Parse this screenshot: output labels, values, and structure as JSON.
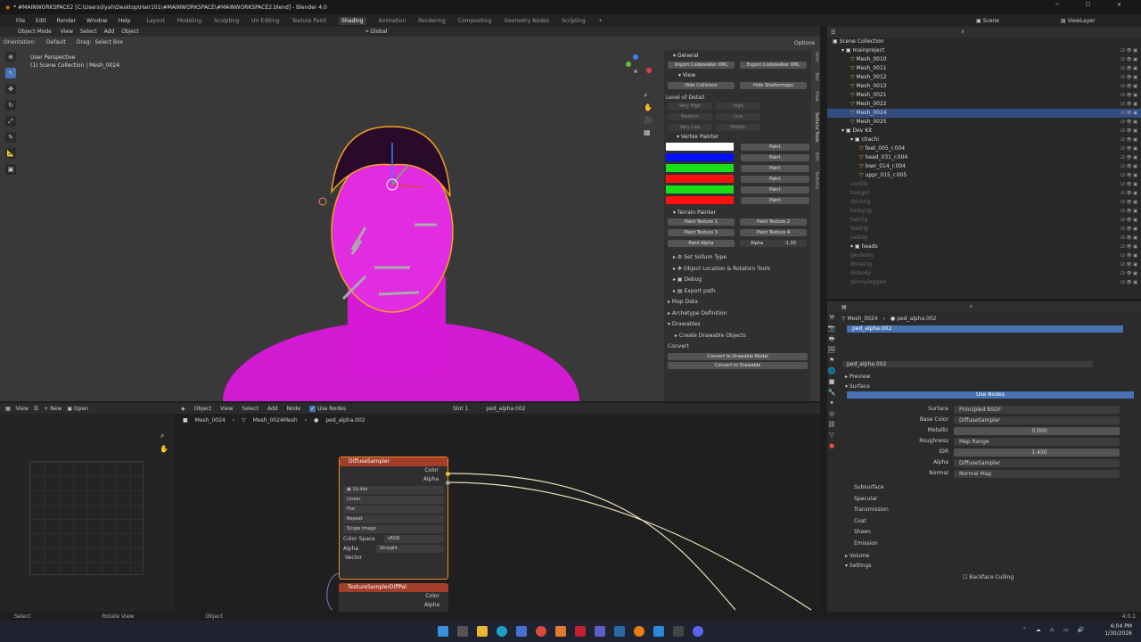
{
  "window": {
    "title": "* #MAINWORKSPACE2 [C:\\Users\\ilyah\\Desktop\\Hair101\\#MAINWORKSPACE\\#MAINWORKSPACE2.blend] - Blender 4.0"
  },
  "menu": [
    "File",
    "Edit",
    "Render",
    "Window",
    "Help"
  ],
  "workspaces": [
    "Layout",
    "Modeling",
    "Sculpting",
    "UV Editing",
    "Texture Paint",
    "Shading",
    "Animation",
    "Rendering",
    "Compositing",
    "Geometry Nodes",
    "Scripting"
  ],
  "active_workspace": "Shading",
  "scene": {
    "label": "Scene",
    "viewlayer": "ViewLayer"
  },
  "viewport": {
    "mode": "Object Mode",
    "view": "View",
    "select": "Select",
    "add": "Add",
    "object": "Object",
    "orientation_label": "Orientation:",
    "orientation": "Default",
    "drag_label": "Drag:",
    "drag": "Select Box",
    "transform": "Global",
    "options": "Options",
    "overlay_title": "User Perspective",
    "overlay_sub": "(1) Scene Collection | Mesh_0024"
  },
  "npanel": {
    "general": "General",
    "import_xml": "Import Codewalker XML",
    "export_xml": "Export Codewalker XML",
    "view": "View",
    "hide_collisions": "Hide Collisions",
    "hide_shattermaps": "Hide Shattermaps",
    "lod_title": "Level of Detail",
    "lod_buttons": [
      "Very High",
      "High",
      "Medium",
      "Low",
      "Very Low",
      "Hidden"
    ],
    "vertex_painter": "Vertex Painter",
    "paint_rows": [
      {
        "color": "#ffffff",
        "label": "Paint"
      },
      {
        "color": "#0010ff",
        "label": "Paint"
      },
      {
        "color": "#18e018",
        "label": "Paint"
      },
      {
        "color": "#ff1010",
        "label": "Paint"
      },
      {
        "color": "#18e018",
        "label": "Paint"
      },
      {
        "color": "#ff1010",
        "label": "Paint"
      }
    ],
    "terrain_painter": "Terrain Painter",
    "terrain_buttons": [
      "Paint Texture 1",
      "Paint Texture 2",
      "Paint Texture 3",
      "Paint Texture 4"
    ],
    "paint_alpha": "Paint Alpha",
    "alpha_label": "Alpha",
    "alpha_value": "-1.00",
    "sections": [
      "Set Sollum Type",
      "Object Location & Rotation Tools",
      "Debug",
      "Export path",
      "Map Data",
      "Archetype Definition",
      "Drawables",
      "Create Drawable Objects"
    ],
    "convert": "Convert",
    "convert_model": "Convert to Drawable Model",
    "convert_drawable": "Convert to Drawable",
    "tabs": [
      "Item",
      "Tool",
      "View",
      "Sollumz Tools",
      "Edit",
      "Sollumz"
    ]
  },
  "outliner": {
    "title": "Scene Collection",
    "items": [
      {
        "name": "mainproject",
        "indent": 1,
        "type": "collection",
        "selected": false
      },
      {
        "name": "Mesh_0010",
        "indent": 2,
        "type": "mesh",
        "selected": false
      },
      {
        "name": "Mesh_0011",
        "indent": 2,
        "type": "mesh",
        "selected": false
      },
      {
        "name": "Mesh_0012",
        "indent": 2,
        "type": "mesh",
        "selected": false
      },
      {
        "name": "Mesh_0013",
        "indent": 2,
        "type": "mesh",
        "selected": false
      },
      {
        "name": "Mesh_0021",
        "indent": 2,
        "type": "mesh",
        "selected": false
      },
      {
        "name": "Mesh_0022",
        "indent": 2,
        "type": "mesh",
        "selected": false
      },
      {
        "name": "Mesh_0024",
        "indent": 2,
        "type": "mesh",
        "selected": true
      },
      {
        "name": "Mesh_0025",
        "indent": 2,
        "type": "mesh",
        "selected": false
      },
      {
        "name": "Dev Kit",
        "indent": 1,
        "type": "collection",
        "selected": false
      },
      {
        "name": "chachi",
        "indent": 2,
        "type": "collection",
        "selected": false
      },
      {
        "name": "feet_005_r.004",
        "indent": 3,
        "type": "mesh",
        "selected": false
      },
      {
        "name": "head_031_r.004",
        "indent": 3,
        "type": "mesh",
        "selected": false
      },
      {
        "name": "lowr_014_r.004",
        "indent": 3,
        "type": "mesh",
        "selected": false
      },
      {
        "name": "uppr_015_r.005",
        "indent": 3,
        "type": "mesh",
        "selected": false
      },
      {
        "name": "vanilla",
        "indent": 2,
        "type": "hidden",
        "selected": false
      },
      {
        "name": "hairgirl",
        "indent": 2,
        "type": "hidden",
        "selected": false
      },
      {
        "name": "thickrig",
        "indent": 2,
        "type": "hidden",
        "selected": false
      },
      {
        "name": "kinkyrig",
        "indent": 2,
        "type": "hidden",
        "selected": false
      },
      {
        "name": "hairrig",
        "indent": 2,
        "type": "hidden",
        "selected": false
      },
      {
        "name": "feetrig",
        "indent": 2,
        "type": "hidden",
        "selected": false
      },
      {
        "name": "nailrig",
        "indent": 2,
        "type": "hidden",
        "selected": false
      },
      {
        "name": "heads",
        "indent": 2,
        "type": "collection",
        "selected": false
      },
      {
        "name": "genbody",
        "indent": 2,
        "type": "hidden",
        "selected": false
      },
      {
        "name": "dressrig",
        "indent": 2,
        "type": "hidden",
        "selected": false
      },
      {
        "name": "skibody",
        "indent": 2,
        "type": "hidden",
        "selected": false
      },
      {
        "name": "skinnylegged",
        "indent": 2,
        "type": "hidden",
        "selected": false
      }
    ]
  },
  "properties": {
    "crumb_object": "Mesh_0024",
    "crumb_material": "ped_alpha.002",
    "material_slot": "ped_alpha.002",
    "material_name": "ped_alpha.002",
    "preview": "Preview",
    "surface_header": "Surface",
    "use_nodes": "Use Nodes",
    "rows": [
      {
        "label": "Surface",
        "value": "Principled BSDF"
      },
      {
        "label": "Base Color",
        "value": "DiffuseSampler"
      },
      {
        "label": "Metallic",
        "value": "0.000"
      },
      {
        "label": "Roughness",
        "value": "Map Range"
      },
      {
        "label": "IOR",
        "value": "1.450"
      },
      {
        "label": "Alpha",
        "value": "DiffuseSampler"
      },
      {
        "label": "Normal",
        "value": "Normal Map"
      }
    ],
    "subsections": [
      "Subsurface",
      "Specular",
      "Transmission",
      "Coat",
      "Sheen",
      "Emission"
    ],
    "volume": "Volume",
    "settings": "Settings",
    "backface": "Backface Culling"
  },
  "node_editor": {
    "menus": [
      "View",
      "Select",
      "Add",
      "Node"
    ],
    "use_nodes": "Use Nodes",
    "object": "Object",
    "slot": "Slot 1",
    "material": "ped_alpha.002",
    "crumbs": [
      "Mesh_0024",
      "Mesh_0024Mesh",
      "ped_alpha.002"
    ],
    "image_editor": {
      "view": "View",
      "new": "New",
      "open": "Open"
    },
    "node1": {
      "title": "DiffuseSampler",
      "out_color": "Color",
      "out_alpha": "Alpha",
      "image": "1A.dds",
      "interp": "Linear",
      "proj": "Flat",
      "ext": "Repeat",
      "source": "Single Image",
      "cs_label": "Color Space",
      "cs_value": "sRGB",
      "alpha_label": "Alpha",
      "alpha_value": "Straight",
      "vector": "Vector"
    },
    "node2": {
      "title": "TextureSamplerDiffPal",
      "out_color": "Color",
      "out_alpha": "Alpha"
    }
  },
  "status": {
    "select": "Select",
    "rotate": "Rotate View",
    "object": "Object",
    "version": "4.0.1"
  },
  "taskbar": {
    "time": "6:04 PM",
    "date": "1/30/2026"
  }
}
